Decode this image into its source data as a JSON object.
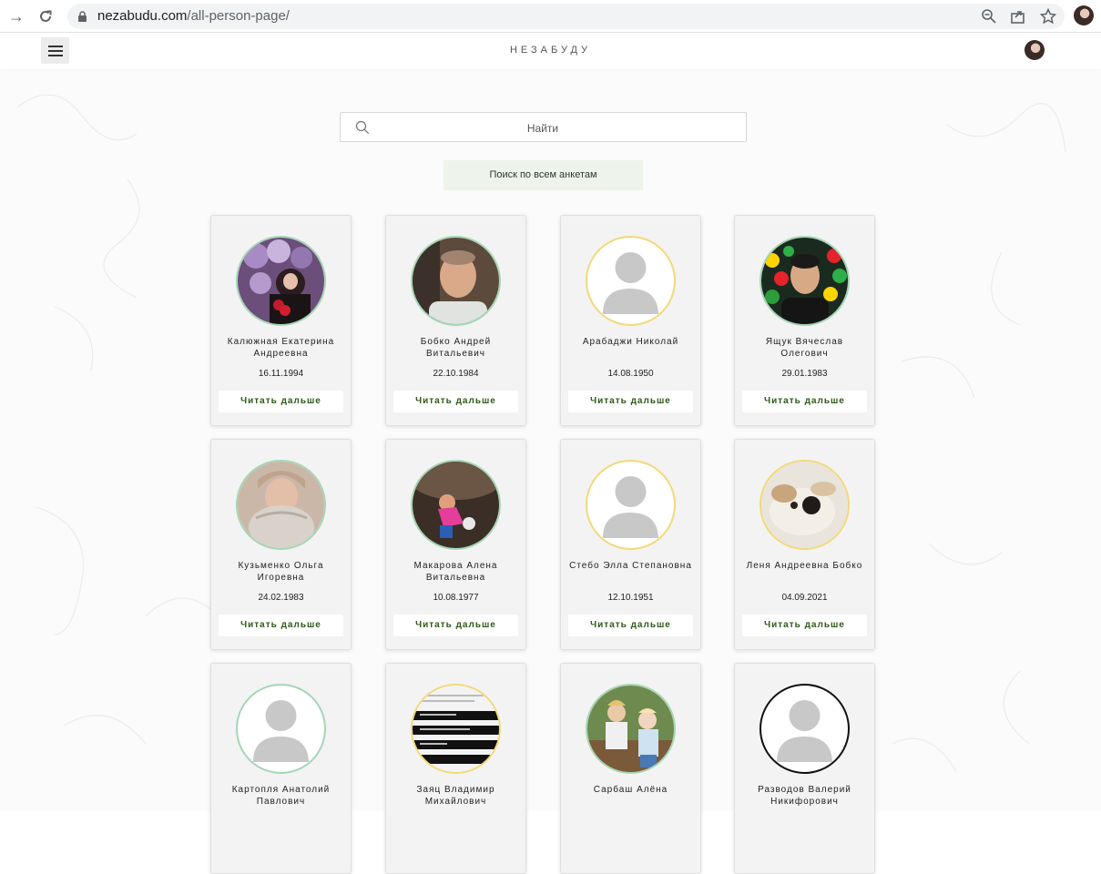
{
  "browser": {
    "url_domain": "nezabudu.com",
    "url_path": "/all-person-page/"
  },
  "site": {
    "title": "НЕЗАБУДУ"
  },
  "search": {
    "placeholder": "Найти",
    "search_all_label": "Поиск по всем анкетам"
  },
  "cards": [
    {
      "name": "Калюжная Екатерина Андреевна",
      "date": "16.11.1994",
      "more": "Читать дальше",
      "photo": "photo-balloons"
    },
    {
      "name": "Бобко Андрей Витальевич",
      "date": "22.10.1984",
      "more": "Читать дальше",
      "photo": "photo-man"
    },
    {
      "name": "Арабаджи Николай",
      "date": "14.08.1950",
      "more": "Читать дальше",
      "photo": "placeholder"
    },
    {
      "name": "Ящук Вячеслав Олегович",
      "date": "29.01.1983",
      "more": "Читать дальше",
      "photo": "photo-balls"
    },
    {
      "name": "Кузьменко Ольга Игоревна",
      "date": "24.02.1983",
      "more": "Читать дальше",
      "photo": "photo-woman-scarf"
    },
    {
      "name": "Макарова Алена Витальевна",
      "date": "10.08.1977",
      "more": "Читать дальше",
      "photo": "photo-cave"
    },
    {
      "name": "Стебо Элла Степановна",
      "date": "12.10.1951",
      "more": "Читать дальше",
      "photo": "placeholder"
    },
    {
      "name": "Леня Андреевна Бобко",
      "date": "04.09.2021",
      "more": "Читать дальше",
      "photo": "photo-dog"
    },
    {
      "name": "Картопля Анатолий Павлович",
      "date": "",
      "more": "",
      "photo": "placeholder"
    },
    {
      "name": "Заяц Владимир Михайлович",
      "date": "",
      "more": "",
      "photo": "photo-screen"
    },
    {
      "name": "Сарбаш Алёна",
      "date": "",
      "more": "",
      "photo": "photo-family"
    },
    {
      "name": "Разводов Валерий Никифорович",
      "date": "",
      "more": "",
      "photo": "placeholder"
    }
  ]
}
